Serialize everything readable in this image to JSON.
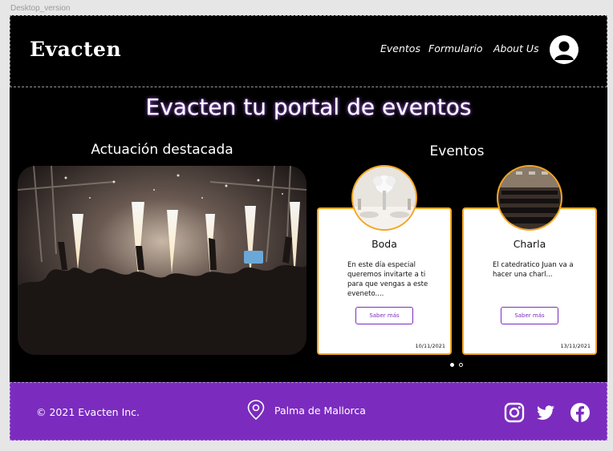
{
  "frame": {
    "label": "Desktop_version"
  },
  "header": {
    "logo": "Evacten",
    "nav": [
      {
        "label": "Eventos"
      },
      {
        "label": "Formulario"
      },
      {
        "label": "About Us"
      }
    ],
    "user_icon": "user-circle-icon"
  },
  "main": {
    "title": "Evacten tu portal de eventos",
    "featured": {
      "title": "Actuación destacada"
    },
    "events": {
      "title": "Eventos",
      "cards": [
        {
          "name": "Boda",
          "description": "En este día especial queremos invitarte a ti para que vengas a este eveneto....",
          "button": "Saber más",
          "date": "10/11/2021"
        },
        {
          "name": "Charla",
          "description": "El catedratico Juan va a hacer una charl...",
          "button": "Saber más",
          "date": "13/11/2021"
        }
      ],
      "carousel": {
        "current": 1,
        "total": 2
      }
    }
  },
  "footer": {
    "copyright": "© 2021 Evacten Inc.",
    "location": "Palma de Mallorca",
    "icons": [
      "location-pin-icon",
      "instagram-icon",
      "twitter-icon",
      "facebook-icon"
    ]
  },
  "colors": {
    "accent": "#7b2cbf",
    "card_border": "#f5a623",
    "background": "#000000"
  }
}
